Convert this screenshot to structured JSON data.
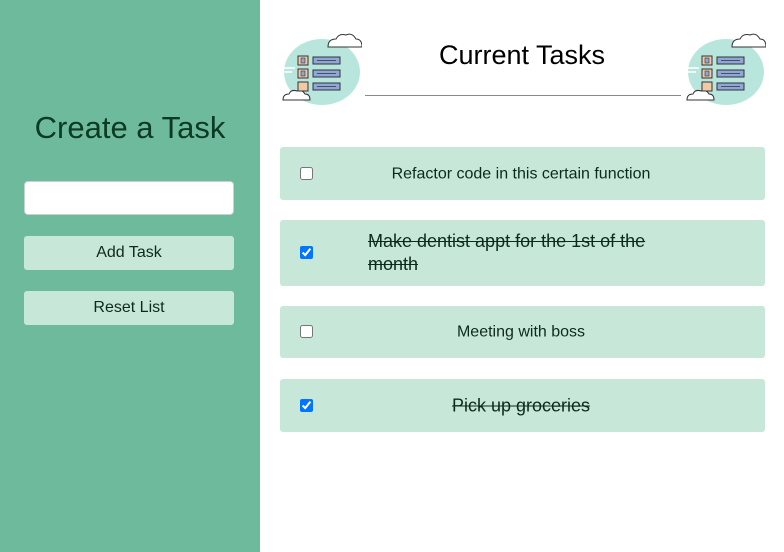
{
  "sidebar": {
    "title": "Create a Task",
    "input_value": "",
    "input_placeholder": "",
    "add_button_label": "Add Task",
    "reset_button_label": "Reset List",
    "background_color": "#6dbb9c"
  },
  "main": {
    "title": "Current Tasks",
    "left_illustration_icon": "task-list-cloud-icon",
    "right_illustration_icon": "task-list-cloud-icon"
  },
  "tasks": [
    {
      "text": "Refactor code in this certain function",
      "completed": false
    },
    {
      "text": "Make dentist appt for the 1st of the month",
      "completed": true
    },
    {
      "text": "Meeting with boss",
      "completed": false
    },
    {
      "text": "Pick up groceries",
      "completed": true
    }
  ],
  "colors": {
    "accent": "#6dbb9c",
    "task_background": "#c7e8d9",
    "text_dark": "#0d2a1c"
  }
}
